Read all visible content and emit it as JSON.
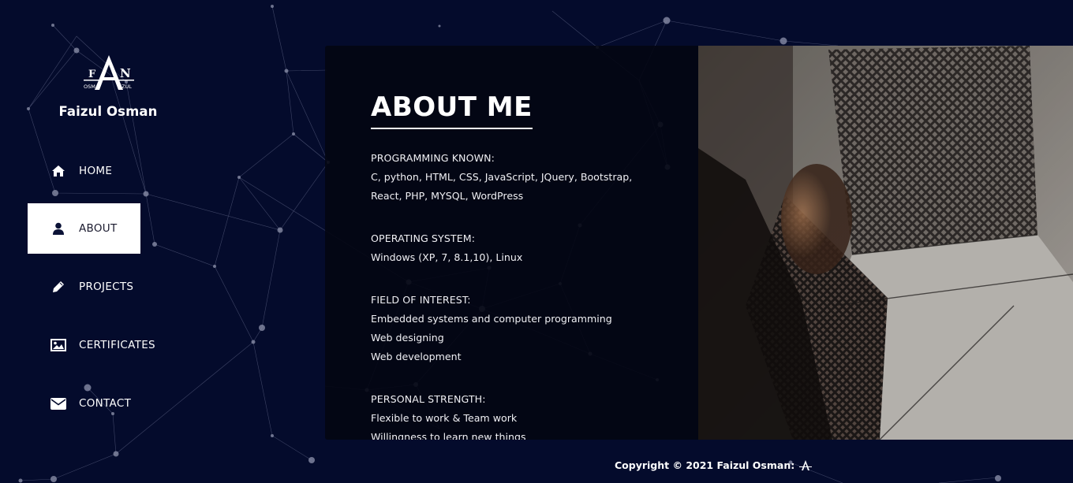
{
  "brand": {
    "logo_text": "FAN",
    "logo_sub_left": "OSM",
    "logo_sub_right": "ZUL",
    "name": "Faizul Osman"
  },
  "nav": [
    {
      "label": "HOME",
      "icon": "home-icon",
      "active": false
    },
    {
      "label": "ABOUT",
      "icon": "user-icon",
      "active": true
    },
    {
      "label": "PROJECTS",
      "icon": "pencil-icon",
      "active": false
    },
    {
      "label": "CERTIFICATES",
      "icon": "image-icon",
      "active": false
    },
    {
      "label": "CONTACT",
      "icon": "envelope-icon",
      "active": false
    }
  ],
  "about": {
    "title": "ABOUT ME",
    "sections": [
      {
        "label": "PROGRAMMING KNOWN:",
        "lines": [
          "C, python, HTML, CSS, JavaScript, JQuery, Bootstrap,",
          "React, PHP, MYSQL, WordPress"
        ]
      },
      {
        "label": "OPERATING SYSTEM:",
        "lines": [
          "Windows (XP, 7, 8.1,10), Linux"
        ]
      },
      {
        "label": "FIELD OF INTEREST:",
        "lines": [
          "Embedded systems and computer programming",
          "Web designing",
          "Web development"
        ]
      },
      {
        "label": "PERSONAL STRENGTH:",
        "lines": [
          "Flexible to work & Team work",
          "Willingness to learn new things"
        ]
      }
    ]
  },
  "footer": {
    "copyright": "Copyright © 2021 Faizul Osman:"
  },
  "colors": {
    "background": "#040b2c",
    "panel": "#03050f",
    "active_nav_bg": "#ffffff",
    "text": "#ffffff"
  }
}
